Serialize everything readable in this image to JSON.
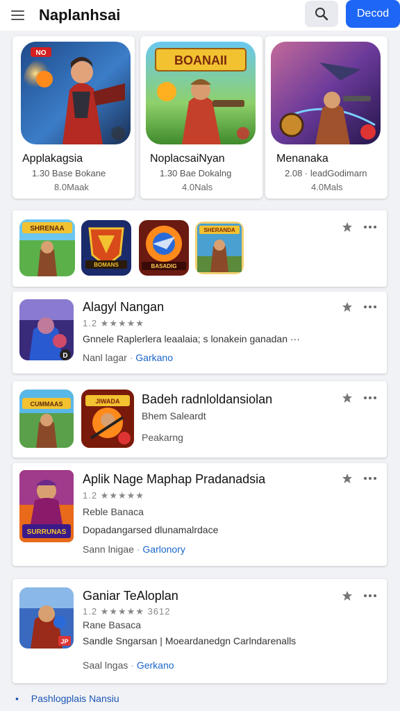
{
  "header": {
    "title": "Naplanhsai",
    "primary_button": "Decod",
    "icons": {
      "menu": "hamburger-menu-icon",
      "search": "search-icon"
    }
  },
  "colors": {
    "accent": "#1e66f5",
    "link": "#1a66c9",
    "background": "#f1f2f5",
    "star": "#777777"
  },
  "featured": [
    {
      "name": "Applakagsia",
      "meta": "1.30  Base Bokane",
      "size": "8.0Maak",
      "badge": "NO"
    },
    {
      "name": "NoplacsaiNyan",
      "meta": "1.30  Bae Dokalng",
      "size": "4.0Nals",
      "banner": "BOANAII"
    },
    {
      "name": "Menanaka",
      "meta": "2.08 · leadGodimarn",
      "size": "4.0Mals"
    }
  ],
  "collection": {
    "icon_labels": [
      "SHRENAA",
      "BOMANS",
      "BASADIG",
      "SHERANDA"
    ]
  },
  "apps": [
    {
      "name": "Alagyl Nangan",
      "rating_text": "1.2 ★★★★★",
      "description": "Gnnele Raplerlera  leaalaia;  s lonakein ganadan  ···",
      "lang": "Nanl lagar",
      "link": "Garkano"
    },
    {
      "name": "Badeh radnloldansiolan",
      "sub": "Bhem Saleardt",
      "lang": "Peakarng",
      "icon_labels": [
        "CUMMAAS",
        "JIWADA"
      ]
    },
    {
      "name": "Aplik  Nage Maphap Pradanadsia",
      "rating_text": "1.2 ★★★★★",
      "sub": "Reble Banaca",
      "description": "Dopadangarsed  dlunamalrdace",
      "lang": "Sann lnigae",
      "link": "Garlonory",
      "icon_label": "SURRUNAS"
    },
    {
      "name": "Ganiar TeAloplan",
      "rating_text": "1.2 ★★★★★  3612",
      "sub": "Rane Basaca",
      "description": "Sandle Sngarsan | Moeardanedgn Carlndarenalls",
      "lang": "Saal lngas",
      "link": "Gerkano",
      "badge": "JP"
    }
  ],
  "footer": {
    "bullet": "•",
    "link": "Pashlogplais Nansiu"
  }
}
